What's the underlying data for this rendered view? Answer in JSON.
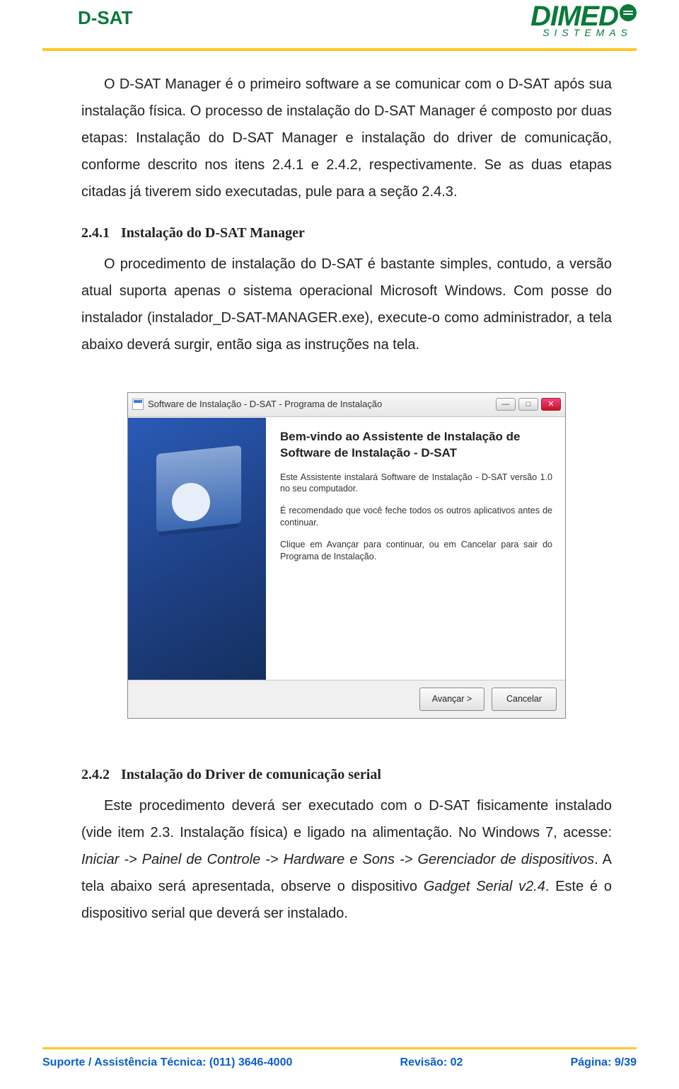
{
  "header": {
    "title": "D-SAT",
    "brand": "DIMED",
    "brand_sub": "SISTEMAS"
  },
  "body": {
    "p1": "O D-SAT Manager é o primeiro software a se comunicar com o D-SAT após sua instalação física. O processo de instalação do D-SAT Manager é composto por duas etapas: Instalação do D-SAT Manager e instalação do driver de comunicação, conforme descrito nos itens 2.4.1 e 2.4.2, respectivamente. Se as duas etapas citadas já tiverem sido executadas, pule para a seção 2.4.3.",
    "s241_num": "2.4.1",
    "s241_title": "Instalação do D-SAT Manager",
    "p2": "O procedimento de instalação do D-SAT é bastante simples, contudo, a versão atual suporta apenas o sistema operacional Microsoft Windows. Com posse do instalador (instalador_D-SAT-MANAGER.exe), execute-o como administrador, a tela abaixo deverá surgir, então siga as instruções na tela.",
    "s242_num": "2.4.2",
    "s242_title": "Instalação do Driver de comunicação serial",
    "p3a": "Este procedimento deverá ser executado com o D-SAT fisicamente instalado (vide item 2.3. Instalação física) e ligado na alimentação. No Windows 7, acesse: ",
    "p3_path": "Iniciar -> Painel de Controle -> Hardware e Sons -> Gerenciador de dispositivos",
    "p3b": ". A tela abaixo será apresentada, observe o dispositivo ",
    "p3_dev": "Gadget Serial v2.4",
    "p3c": ". Este é o dispositivo serial que deverá ser instalado."
  },
  "installer": {
    "title": "Software de Instalação - D-SAT - Programa de Instalação",
    "heading": "Bem-vindo ao Assistente de Instalação de Software de Instalação - D-SAT",
    "para1": "Este Assistente instalará Software de Instalação - D-SAT versão 1.0 no seu computador.",
    "para2": "É recomendado que você feche todos os outros aplicativos antes de continuar.",
    "para3": "Clique em Avançar para continuar, ou em Cancelar para sair do Programa de Instalação.",
    "btn_next": "Avançar >",
    "btn_cancel": "Cancelar"
  },
  "footer": {
    "support": "Suporte / Assistência Técnica: (011) 3646-4000",
    "revision": "Revisão: 02",
    "page_label": "Página: ",
    "page_current": "9",
    "page_sep": "/",
    "page_total": "39"
  }
}
